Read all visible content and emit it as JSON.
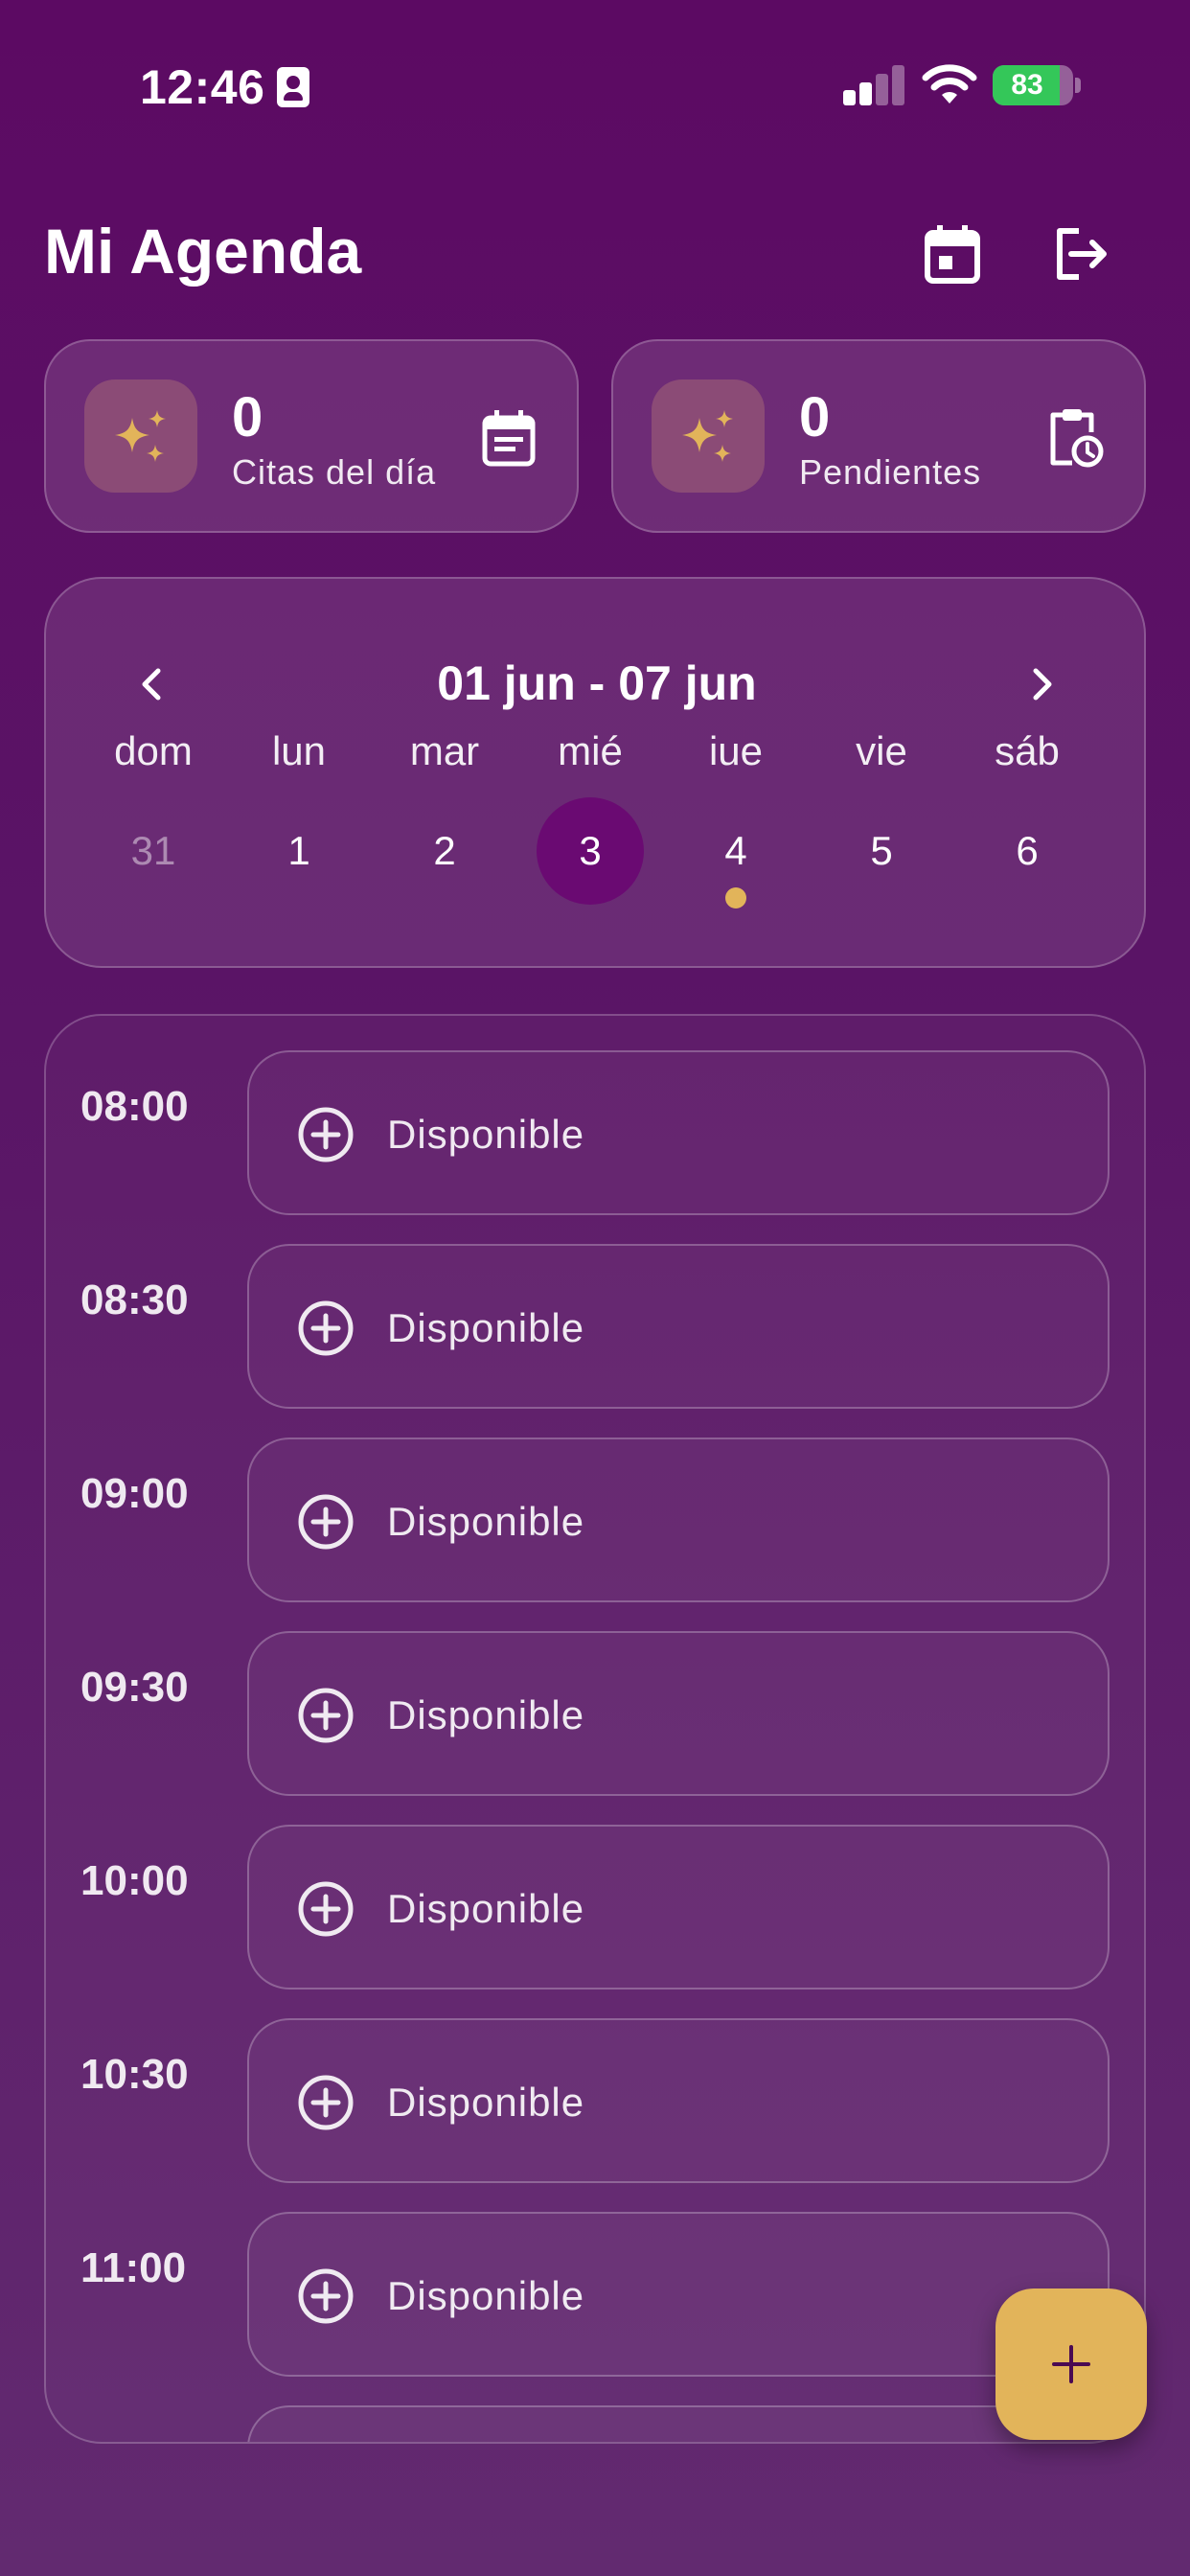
{
  "status_bar": {
    "time": "12:46",
    "battery_percent": "83",
    "battery_level": 0.83,
    "icons": [
      "id-card-icon",
      "cellular-signal-icon",
      "wifi-icon",
      "battery-charging-icon"
    ]
  },
  "header": {
    "title": "Mi Agenda",
    "actions": [
      "calendar-icon",
      "logout-icon"
    ]
  },
  "stats": [
    {
      "value": "0",
      "label": "Citas del día",
      "icon": "sparkles-icon",
      "side_icon": "event-note-icon"
    },
    {
      "value": "0",
      "label": "Pendientes",
      "icon": "sparkles-icon",
      "side_icon": "clipboard-clock-icon"
    }
  ],
  "calendar": {
    "range": "01 jun - 07 jun",
    "days": [
      {
        "dow": "dom",
        "num": "31",
        "state": "muted"
      },
      {
        "dow": "lun",
        "num": "1",
        "state": "normal"
      },
      {
        "dow": "mar",
        "num": "2",
        "state": "normal"
      },
      {
        "dow": "mié",
        "num": "3",
        "state": "selected"
      },
      {
        "dow": "iue",
        "num": "4",
        "state": "has-event"
      },
      {
        "dow": "vie",
        "num": "5",
        "state": "normal"
      },
      {
        "dow": "sáb",
        "num": "6",
        "state": "normal"
      }
    ]
  },
  "schedule": {
    "slots": [
      {
        "time": "08:00",
        "label": "Disponible"
      },
      {
        "time": "08:30",
        "label": "Disponible"
      },
      {
        "time": "09:00",
        "label": "Disponible"
      },
      {
        "time": "09:30",
        "label": "Disponible"
      },
      {
        "time": "10:00",
        "label": "Disponible"
      },
      {
        "time": "10:30",
        "label": "Disponible"
      },
      {
        "time": "11:00",
        "label": "Disponible"
      }
    ]
  },
  "fab": {
    "icon": "plus-icon"
  },
  "colors": {
    "background": "#5c0a63",
    "accent": "#e2b45a",
    "selected_day": "#6a0a72",
    "battery": "#34c759"
  }
}
